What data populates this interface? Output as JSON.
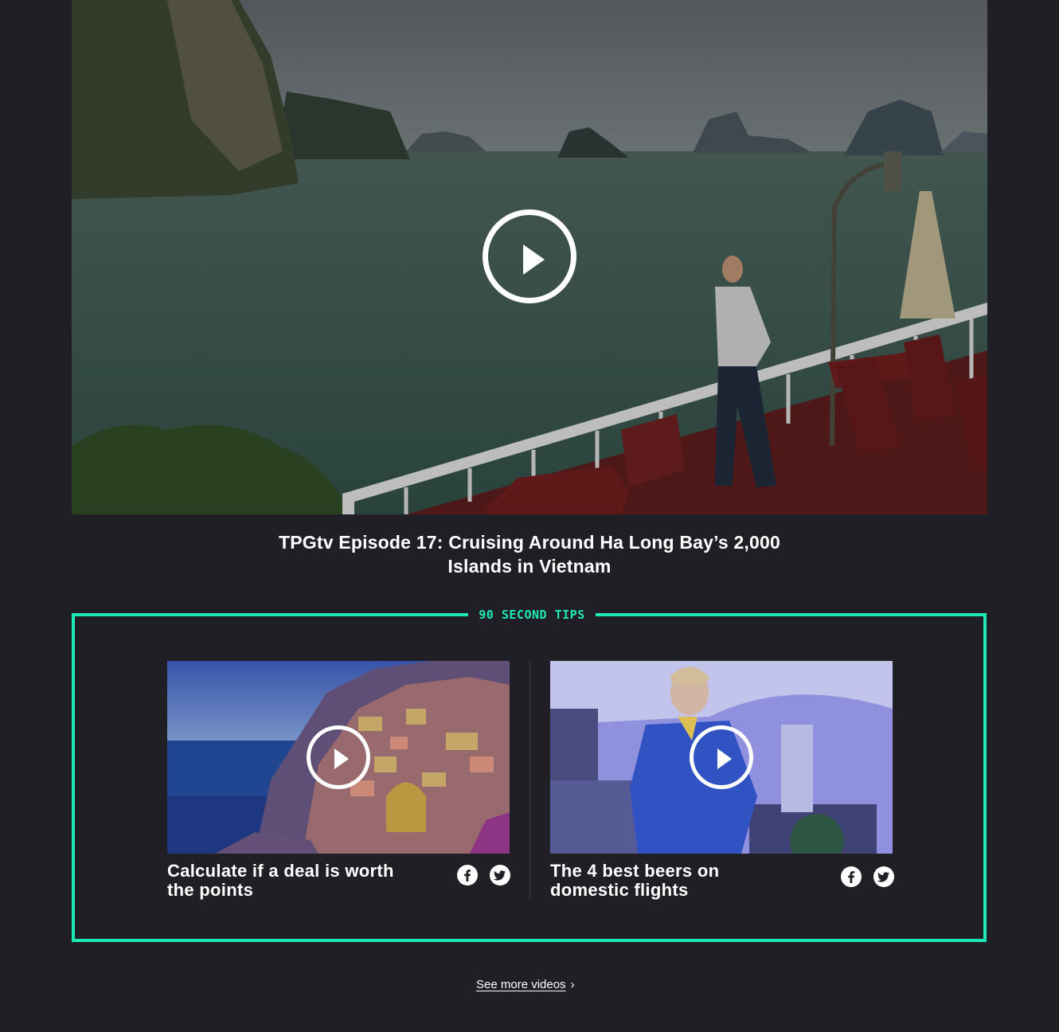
{
  "hero": {
    "title": "TPGtv Episode 17: Cruising Around Ha Long Bay’s 2,000 Islands in Vietnam",
    "play_icon": "play-icon"
  },
  "tips": {
    "label": "90 SECOND TIPS",
    "accent_color": "#1de9b6",
    "cards": [
      {
        "title": "Calculate if a deal is worth the points"
      },
      {
        "title": "The 4 best beers on domestic flights"
      }
    ],
    "share_icons": [
      "facebook-icon",
      "twitter-icon"
    ]
  },
  "footer": {
    "see_more": "See more videos",
    "chevron": "›"
  }
}
